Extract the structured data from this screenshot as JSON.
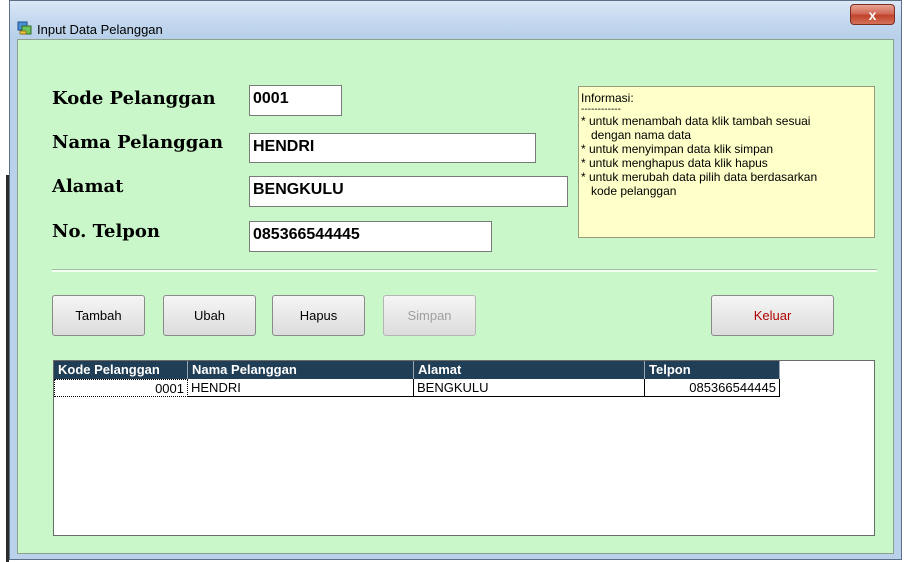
{
  "window": {
    "title": "Input Data Pelanggan",
    "close_label": "x"
  },
  "form": {
    "kode": {
      "label": "Kode Pelanggan",
      "value": "0001"
    },
    "nama": {
      "label": "Nama Pelanggan",
      "value": "HENDRI"
    },
    "alamat": {
      "label": "Alamat",
      "value": "BENGKULU"
    },
    "telpon": {
      "label": "No. Telpon",
      "value": "085366544445"
    }
  },
  "info": {
    "title": "Informasi:",
    "separator": "------------",
    "lines": [
      {
        "first": "* untuk menambah data klik tambah sesuai",
        "second": "dengan nama data"
      },
      {
        "first": "* untuk menyimpan data klik simpan",
        "second": ""
      },
      {
        "first": "* untuk menghapus data klik hapus",
        "second": ""
      },
      {
        "first": "* untuk merubah data pilih data berdasarkan",
        "second": "kode pelanggan"
      }
    ]
  },
  "buttons": {
    "tambah": "Tambah",
    "ubah": "Ubah",
    "hapus": "Hapus",
    "simpan": "Simpan",
    "keluar": "Keluar"
  },
  "grid": {
    "columns": [
      "Kode Pelanggan",
      "Nama Pelanggan",
      "Alamat",
      "Telpon"
    ],
    "rows": [
      [
        "0001",
        "HENDRI",
        "BENGKULU",
        "085366544445"
      ]
    ]
  },
  "colors": {
    "client_background": "#c9f7c9",
    "info_background": "#ffffc9",
    "grid_header": "#203f57",
    "keluar_text": "#b00000"
  }
}
